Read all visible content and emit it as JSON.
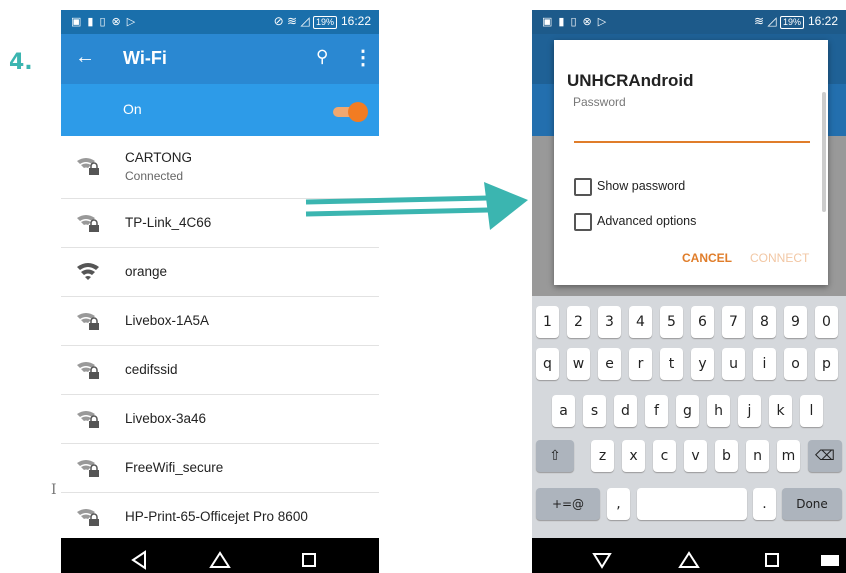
{
  "step_label": "4.",
  "left_phone": {
    "status_time": "16:22",
    "battery": "19%",
    "title": "Wi-Fi",
    "toggle_label": "On",
    "networks": [
      {
        "name": "CARTONG",
        "status": "Connected",
        "icon": "wifi-lock-icon"
      },
      {
        "name": "TP-Link_4C66",
        "icon": "wifi-lock-icon"
      },
      {
        "name": "orange",
        "icon": "wifi-icon"
      },
      {
        "name": "Livebox-1A5A",
        "icon": "wifi-lock-icon"
      },
      {
        "name": "cedifssid",
        "icon": "wifi-lock-icon"
      },
      {
        "name": "Livebox-3a46",
        "icon": "wifi-lock-icon"
      },
      {
        "name": "FreeWifi_secure",
        "icon": "wifi-lock-icon"
      },
      {
        "name": "HP-Print-65-Officejet Pro 8600",
        "icon": "wifi-lock-icon"
      }
    ]
  },
  "right_phone": {
    "status_time": "16:22",
    "battery": "19%",
    "dialog": {
      "title": "UNHCRAndroid",
      "password_label": "Password",
      "show_password": "Show password",
      "advanced_options": "Advanced options",
      "cancel": "CANCEL",
      "connect": "CONNECT"
    },
    "keyboard": {
      "row1": [
        "1",
        "2",
        "3",
        "4",
        "5",
        "6",
        "7",
        "8",
        "9",
        "0"
      ],
      "row2": [
        "q",
        "w",
        "e",
        "r",
        "t",
        "y",
        "u",
        "i",
        "o",
        "p"
      ],
      "row3": [
        "a",
        "s",
        "d",
        "f",
        "g",
        "h",
        "j",
        "k",
        "l"
      ],
      "row4": [
        "z",
        "x",
        "c",
        "v",
        "b",
        "n",
        "m"
      ],
      "symbols": "+=@",
      "comma": ",",
      "period": ".",
      "period_hint": "?!",
      "done": "Done"
    }
  },
  "colors": {
    "accent": "#f27c22",
    "teal": "#3bb5b0",
    "appbar": "#2a88d2"
  }
}
